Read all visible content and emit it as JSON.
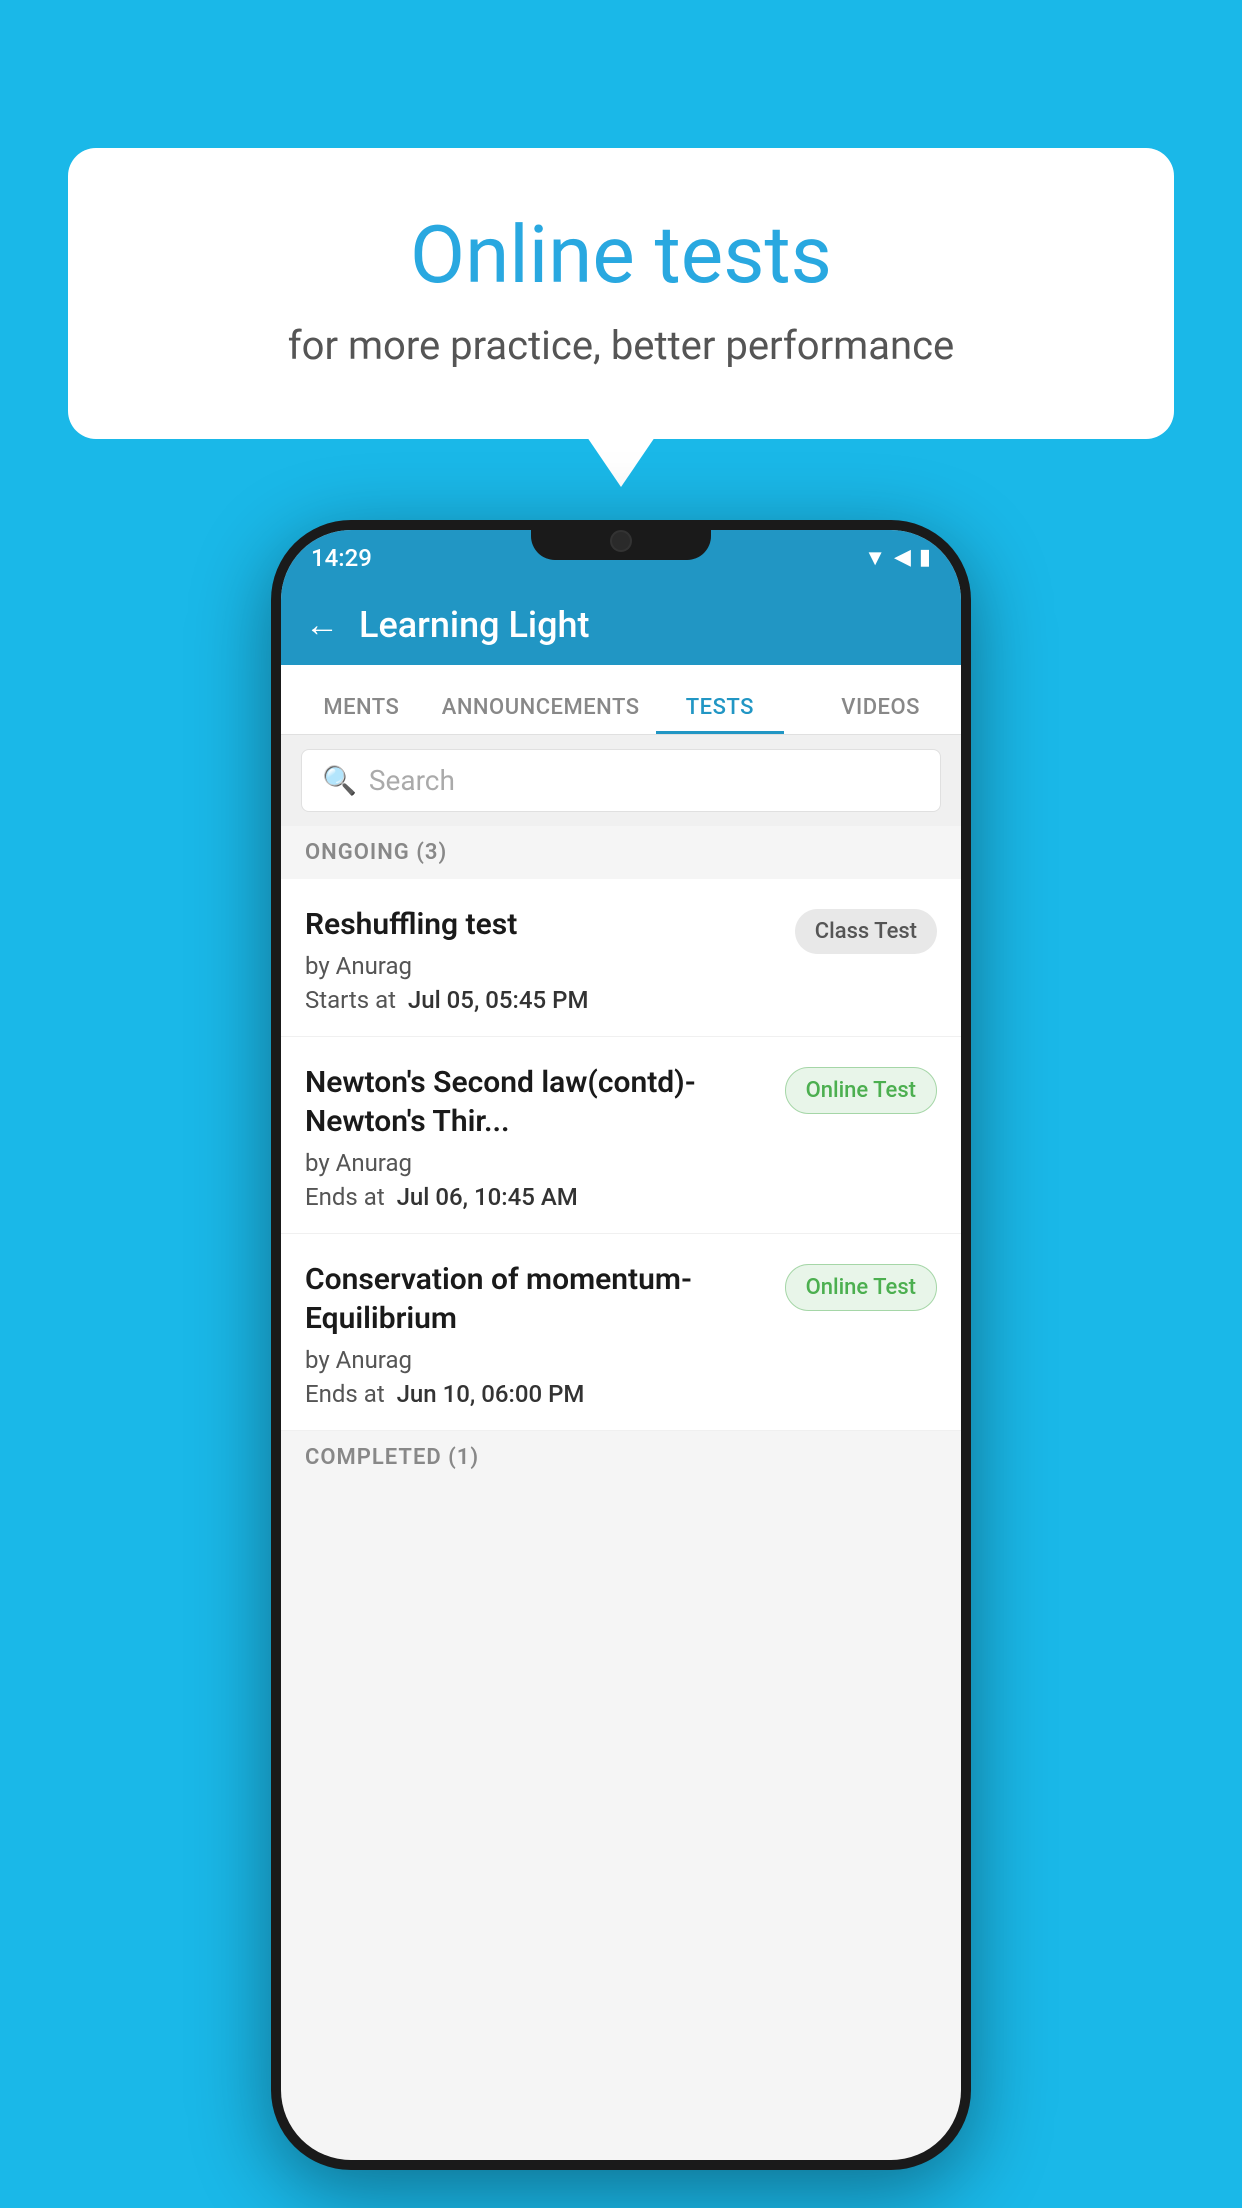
{
  "background": {
    "color": "#1ab8e8"
  },
  "bubble": {
    "title": "Online tests",
    "subtitle": "for more practice, better performance"
  },
  "phone": {
    "status_bar": {
      "time": "14:29",
      "icons": "▼◀▮"
    },
    "header": {
      "back_label": "←",
      "title": "Learning Light"
    },
    "tabs": [
      {
        "label": "MENTS",
        "active": false
      },
      {
        "label": "ANNOUNCEMENTS",
        "active": false
      },
      {
        "label": "TESTS",
        "active": true
      },
      {
        "label": "VIDEOS",
        "active": false
      }
    ],
    "search": {
      "placeholder": "Search"
    },
    "sections": [
      {
        "label": "ONGOING (3)",
        "items": [
          {
            "name": "Reshuffling test",
            "author": "by Anurag",
            "time_label": "Starts at",
            "time_value": "Jul 05, 05:45 PM",
            "badge": "Class Test",
            "badge_type": "class"
          },
          {
            "name": "Newton's Second law(contd)-Newton's Thir...",
            "author": "by Anurag",
            "time_label": "Ends at",
            "time_value": "Jul 06, 10:45 AM",
            "badge": "Online Test",
            "badge_type": "online"
          },
          {
            "name": "Conservation of momentum-Equilibrium",
            "author": "by Anurag",
            "time_label": "Ends at",
            "time_value": "Jun 10, 06:00 PM",
            "badge": "Online Test",
            "badge_type": "online"
          }
        ]
      }
    ],
    "completed_label": "COMPLETED (1)"
  }
}
